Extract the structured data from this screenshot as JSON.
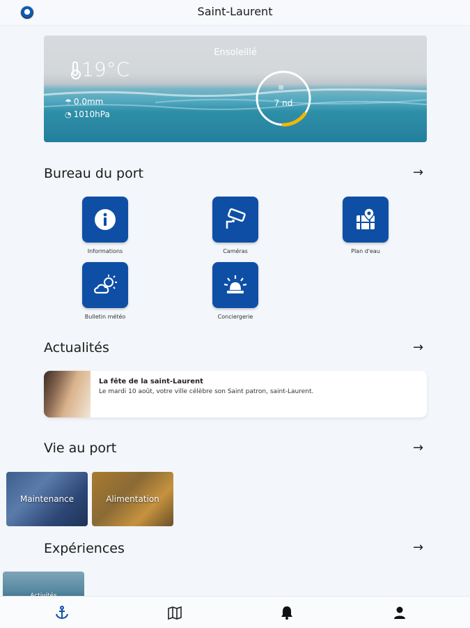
{
  "header": {
    "title": "Saint-Laurent"
  },
  "weather": {
    "condition": "Ensoleillé",
    "temperature": "19°C",
    "rain": "0.0mm",
    "pressure": "1010hPa",
    "wind": "7 nd",
    "wind_gauge_fraction": 0.15
  },
  "sections": {
    "bureau": {
      "title": "Bureau du port"
    },
    "actualites": {
      "title": "Actualités"
    },
    "vie": {
      "title": "Vie au port"
    },
    "experiences": {
      "title": "Expériences"
    }
  },
  "tiles": [
    {
      "label": "Informations",
      "icon": "info-icon"
    },
    {
      "label": "Caméras",
      "icon": "camera-icon"
    },
    {
      "label": "Plan d'eau",
      "icon": "map-pin-icon"
    },
    {
      "label": "Bulletin météo",
      "icon": "weather-icon"
    },
    {
      "label": "Conciergerie",
      "icon": "siren-icon"
    }
  ],
  "news": [
    {
      "title": "La fête de la saint-Laurent",
      "desc": "Le mardi 10 août, votre ville célèbre son Saint patron, saint-Laurent."
    }
  ],
  "vie_cards": [
    {
      "label": "Maintenance"
    },
    {
      "label": "Alimentation"
    }
  ],
  "experience_cards": [
    {
      "label": "Activités"
    }
  ],
  "bottom_nav": [
    {
      "icon": "anchor-icon",
      "active": true
    },
    {
      "icon": "map-icon",
      "active": false
    },
    {
      "icon": "bell-icon",
      "active": false
    },
    {
      "icon": "user-icon",
      "active": false
    }
  ],
  "colors": {
    "primary": "#0e4fa5",
    "accent": "#f2b705"
  }
}
